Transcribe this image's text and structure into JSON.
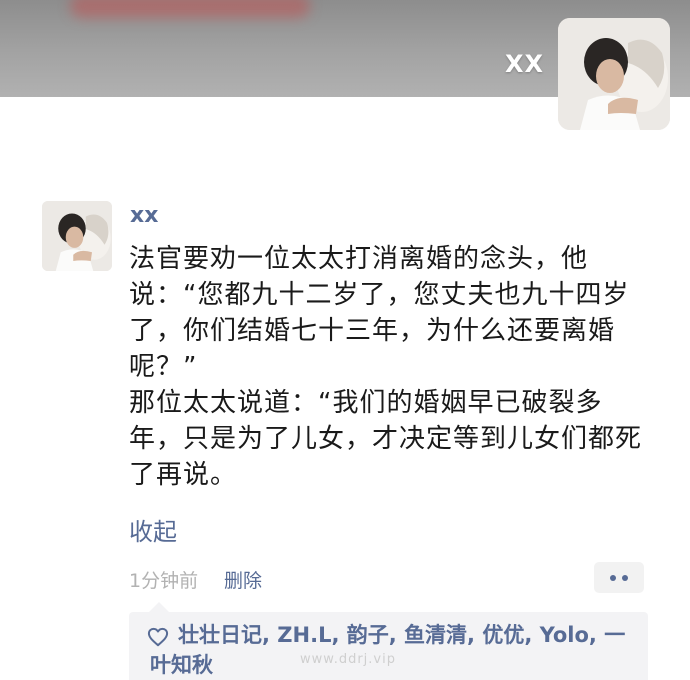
{
  "header": {
    "user_name": "XX"
  },
  "post": {
    "author": "xx",
    "paragraphs": [
      "法官要劝一位太太打消离婚的念头，他说：“您都九十二岁了，您丈夫也九十四岁了，你们结婚七十三年，为什么还要离婚呢？”",
      "那位太太说道：“我们的婚姻早已破裂多年，只是为了儿女，才决定等到儿女们都死了再说。"
    ],
    "collapse_label": "收起",
    "time": "1分钟前",
    "delete_label": "删除"
  },
  "likes": {
    "icon": "heart-icon",
    "names_text": "壮壮日记, ZH.L, 韵子, 鱼清清, 优优, Yolo, 一叶知秋"
  },
  "watermark": "www.ddrj.vip",
  "colors": {
    "link": "#576b95",
    "likes_bg": "#f3f3f5",
    "meta": "#b2b2b2"
  }
}
